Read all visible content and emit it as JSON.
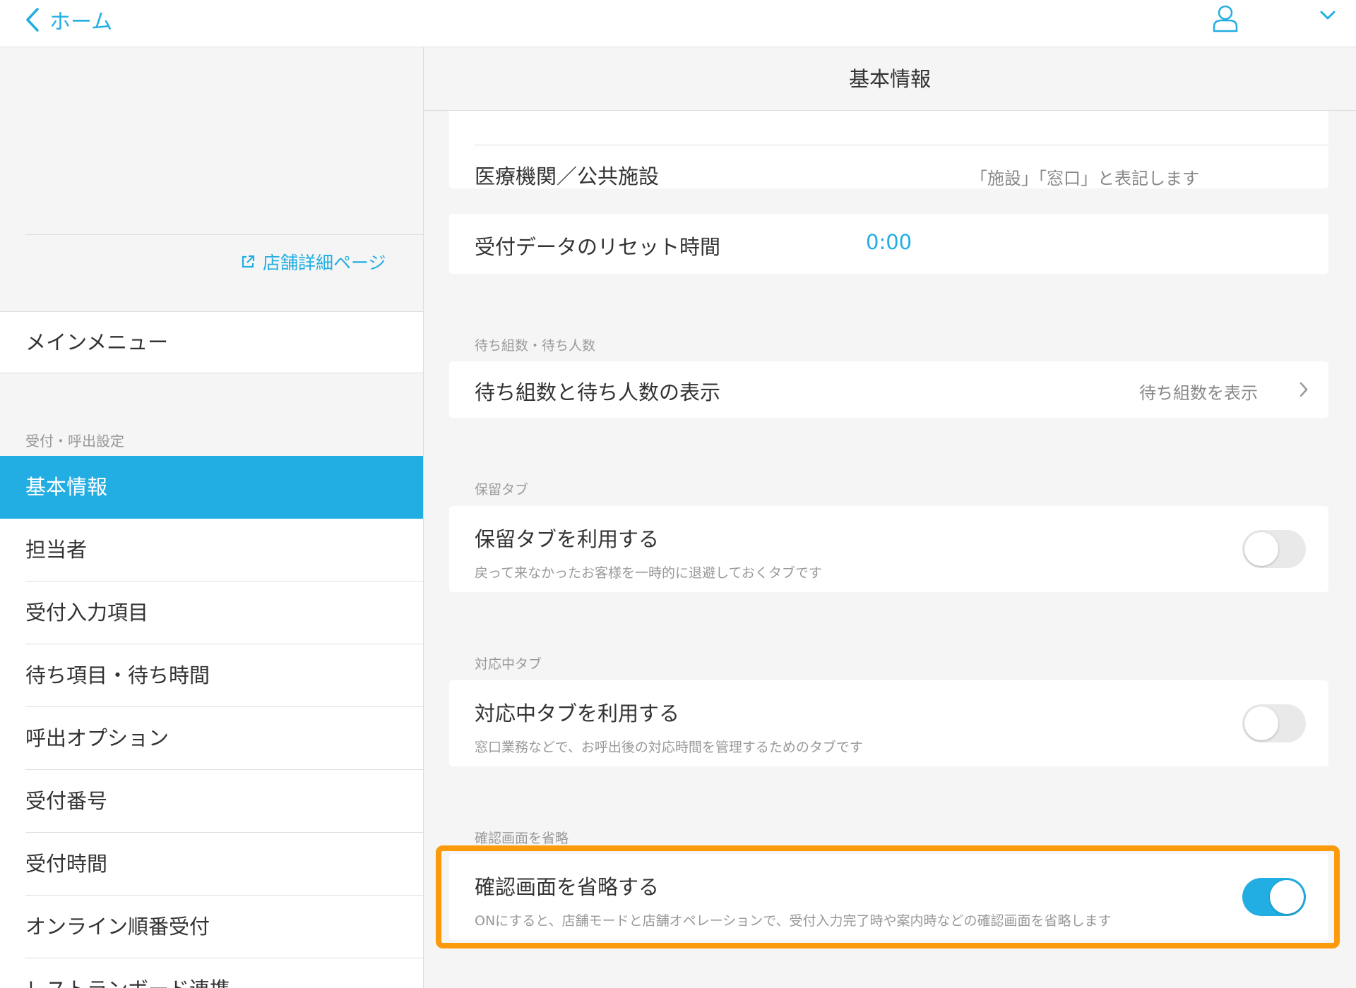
{
  "topbar": {
    "back_label": "ホーム",
    "back_icon": "chevron-left-icon",
    "user_icon": "user-icon",
    "menu_icon": "chevron-down-icon"
  },
  "sidebar": {
    "store_link": "店舗詳細ページ",
    "main_menu": "メインメニュー",
    "section_label": "受付・呼出設定",
    "items": [
      {
        "label": "基本情報",
        "active": true
      },
      {
        "label": "担当者"
      },
      {
        "label": "受付入力項目"
      },
      {
        "label": "待ち項目・待ち時間"
      },
      {
        "label": "呼出オプション"
      },
      {
        "label": "受付番号"
      },
      {
        "label": "受付時間"
      },
      {
        "label": "オンライン順番受付"
      },
      {
        "label": "レストランボード連携"
      }
    ]
  },
  "content": {
    "header_title": "基本情報",
    "facility": {
      "title": "医療機関／公共施設",
      "value": "「施設」「窓口」と表記します"
    },
    "reset": {
      "title": "受付データのリセット時間",
      "value": "0:00"
    },
    "waiting": {
      "section": "待ち組数・待ち人数",
      "title": "待ち組数と待ち人数の表示",
      "value": "待ち組数を表示"
    },
    "hold": {
      "section": "保留タブ",
      "title": "保留タブを利用する",
      "desc": "戻って来なかったお客様を一時的に退避しておくタブです",
      "enabled": false
    },
    "inprogress": {
      "section": "対応中タブ",
      "title": "対応中タブを利用する",
      "desc": "窓口業務などで、お呼出後の対応時間を管理するためのタブです",
      "enabled": false
    },
    "skip": {
      "section": "確認画面を省略",
      "title": "確認画面を省略する",
      "desc": "ONにすると、店舗モードと店舗オペレーションで、受付入力完了時や案内時などの確認画面を省略します",
      "enabled": true
    }
  },
  "colors": {
    "accent": "#22aee3",
    "highlight": "#fb9a0a"
  }
}
